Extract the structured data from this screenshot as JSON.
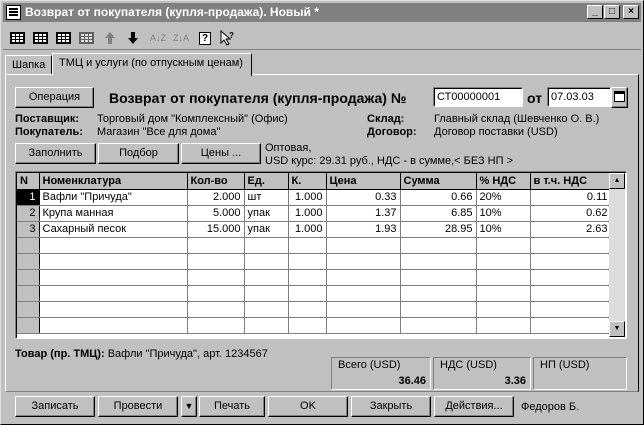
{
  "window": {
    "title": "Возврат от покупателя (купля-продажа). Новый *",
    "minimize": "_",
    "maximize": "□",
    "close": "×"
  },
  "toolbar": {
    "icons": [
      "table-new-icon",
      "table-copy-icon",
      "table-edit-icon",
      "table-delete-icon",
      "move-up-icon",
      "move-down-icon",
      "sort-asc-icon",
      "sort-desc-icon",
      "help-icon",
      "context-help-icon"
    ]
  },
  "tabs": [
    {
      "label": "Шапка"
    },
    {
      "label": "ТМЦ и услуги (по отпускным ценам)"
    }
  ],
  "header": {
    "operation_button": "Операция",
    "doc_title": "Возврат от покупателя (купля-продажа) №",
    "doc_number": "СТ00000001",
    "date_label": "от",
    "date": "07.03.03",
    "supplier_label": "Поставщик:",
    "supplier": "Торговый дом \"Комплексный\" (Офис)",
    "buyer_label": "Покупатель:",
    "buyer": "Магазин \"Все для дома\"",
    "warehouse_label": "Склад:",
    "warehouse": "Главный склад (Шевченко О. В.)",
    "contract_label": "Договор:",
    "contract": "Договор поставки (USD)"
  },
  "actions": {
    "fill": "Заполнить",
    "pick": "Подбор",
    "prices": "Цены ...",
    "price_info_1": "Оптовая,",
    "price_info_2": "USD курс: 29.31 руб., НДС - в сумме,< БЕЗ НП >"
  },
  "table": {
    "columns": [
      "N",
      "Номенклатура",
      "Кол-во",
      "Ед.",
      "К.",
      "Цена",
      "Сумма",
      "% НДС",
      "в т.ч. НДС"
    ],
    "rows": [
      [
        "1",
        "Вафли \"Причуда\"",
        "2.000",
        "шт",
        "1.000",
        "0.33",
        "0.66",
        "20%",
        "0.11"
      ],
      [
        "2",
        "Крупа манная",
        "5.000",
        "упак",
        "1.000",
        "1.37",
        "6.85",
        "10%",
        "0.62"
      ],
      [
        "3",
        "Сахарный песок",
        "15.000",
        "упак",
        "1.000",
        "1.93",
        "28.95",
        "10%",
        "2.63"
      ]
    ]
  },
  "item_info": {
    "label": "Товар (пр. ТМЦ):",
    "value": " Вафли \"Причуда\", арт. 1234567"
  },
  "totals": {
    "total_label": "Всего (USD)",
    "total_value": "36.46",
    "vat_label": "НДС (USD)",
    "vat_value": "3.36",
    "np_label": "НП (USD)",
    "np_value": ""
  },
  "footer": {
    "save": "Записать",
    "post": "Провести",
    "post_dropdown": "▼",
    "print": "Печать",
    "ok": "OK",
    "close": "Закрыть",
    "actions": "Действия...",
    "user": "Федоров Б."
  }
}
